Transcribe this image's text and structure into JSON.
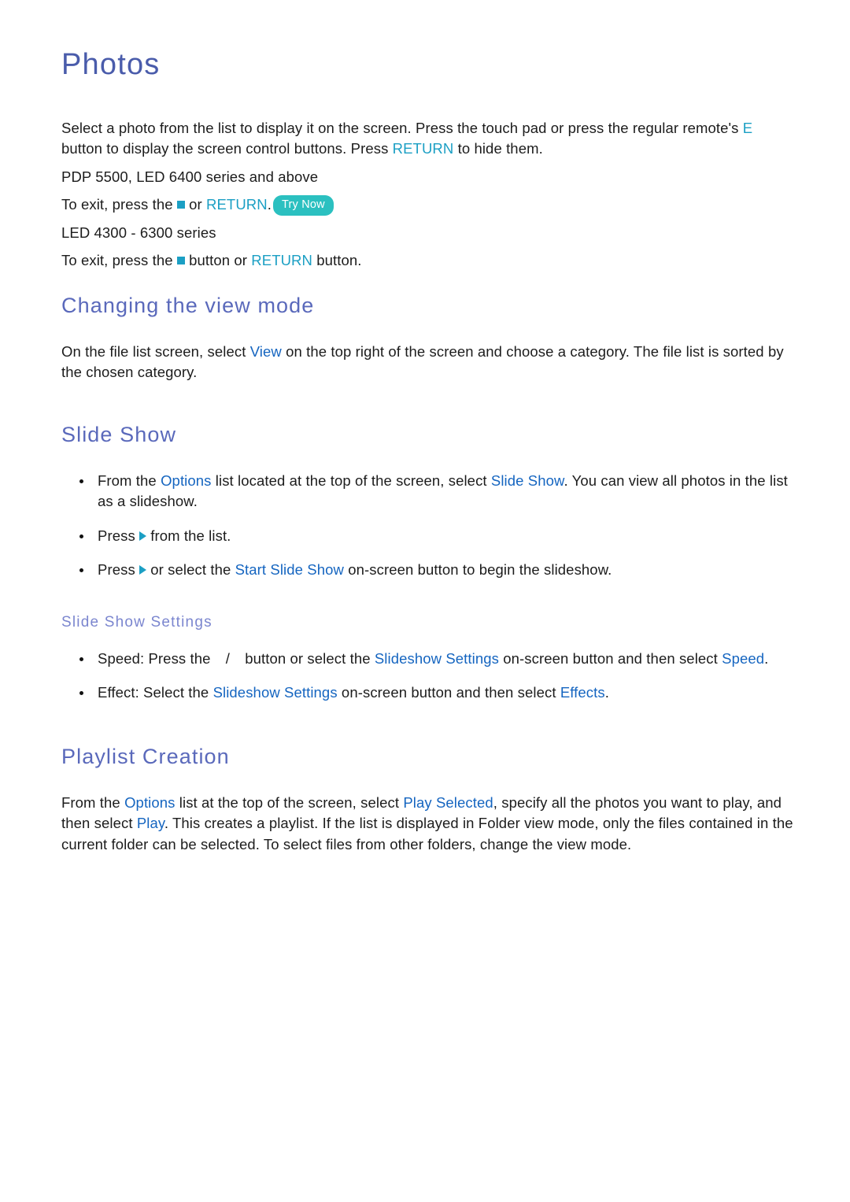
{
  "page": {
    "title": "Photos",
    "intro": {
      "line1_a": "Select a photo from the list to display it on the screen. Press the touch pad or press the regular remote's ",
      "key_e": "E",
      "line1_b": " button to display the screen control buttons. Press ",
      "return_1": "RETURN",
      "line1_c": " to hide them.",
      "models_1": "PDP 5500, LED 6400 series and above",
      "exit_1_a": "To exit, press the ",
      "exit_1_b": " or ",
      "return_2": "RETURN",
      "exit_1_c": ".",
      "try_now": "Try Now",
      "models_2": "LED 4300 - 6300 series",
      "exit_2_a": "To exit, press the ",
      "exit_2_b": " button or ",
      "return_3": "RETURN",
      "exit_2_c": " button."
    },
    "view_mode": {
      "heading": "Changing the view mode",
      "para_a": "On the file list screen, select ",
      "link_view": "View",
      "para_b": " on the top right of the screen and choose a category. The file list is sorted by the chosen category."
    },
    "slide_show": {
      "heading": "Slide Show",
      "bullet1_a": "From the ",
      "bullet1_options": "Options",
      "bullet1_b": " list located at the top of the screen, select ",
      "bullet1_slideshow": "Slide Show",
      "bullet1_c": ". You can view all photos in the list as a slideshow.",
      "bullet2_a": "Press ",
      "bullet2_b": " from the list.",
      "bullet3_a": "Press ",
      "bullet3_b": " or select the ",
      "bullet3_start": "Start Slide Show",
      "bullet3_c": " on-screen button to begin the slideshow."
    },
    "slide_show_settings": {
      "heading": "Slide Show Settings",
      "bullet1_a": "Speed: Press the ",
      "bullet1_slash": "/",
      "bullet1_b": " button or select the ",
      "bullet1_link1": "Slideshow Settings",
      "bullet1_c": " on-screen button and then select ",
      "bullet1_link2": "Speed",
      "bullet1_d": ".",
      "bullet2_a": "Effect: Select the ",
      "bullet2_link1": "Slideshow Settings",
      "bullet2_b": " on-screen button and then select ",
      "bullet2_link2": "Effects",
      "bullet2_c": "."
    },
    "playlist": {
      "heading": "Playlist Creation",
      "para_a": "From the ",
      "link_options": "Options",
      "para_b": " list at the top of the screen, select ",
      "link_play_selected": "Play Selected",
      "para_c": ", specify all the photos you want to play, and then select ",
      "link_play": "Play",
      "para_d": ". This creates a playlist. If the list is displayed in Folder view mode, only the files contained in the current folder can be selected. To select files from other folders, change the view mode."
    },
    "colors": {
      "heading_primary": "#4a5cab",
      "heading_secondary": "#5a69bb",
      "heading_tertiary": "#7b86cf",
      "link_blue": "#1565c0",
      "accent_teal": "#1b9fc4",
      "pill_bg": "#2bc0c0",
      "body_text": "#1c1c1c"
    }
  }
}
